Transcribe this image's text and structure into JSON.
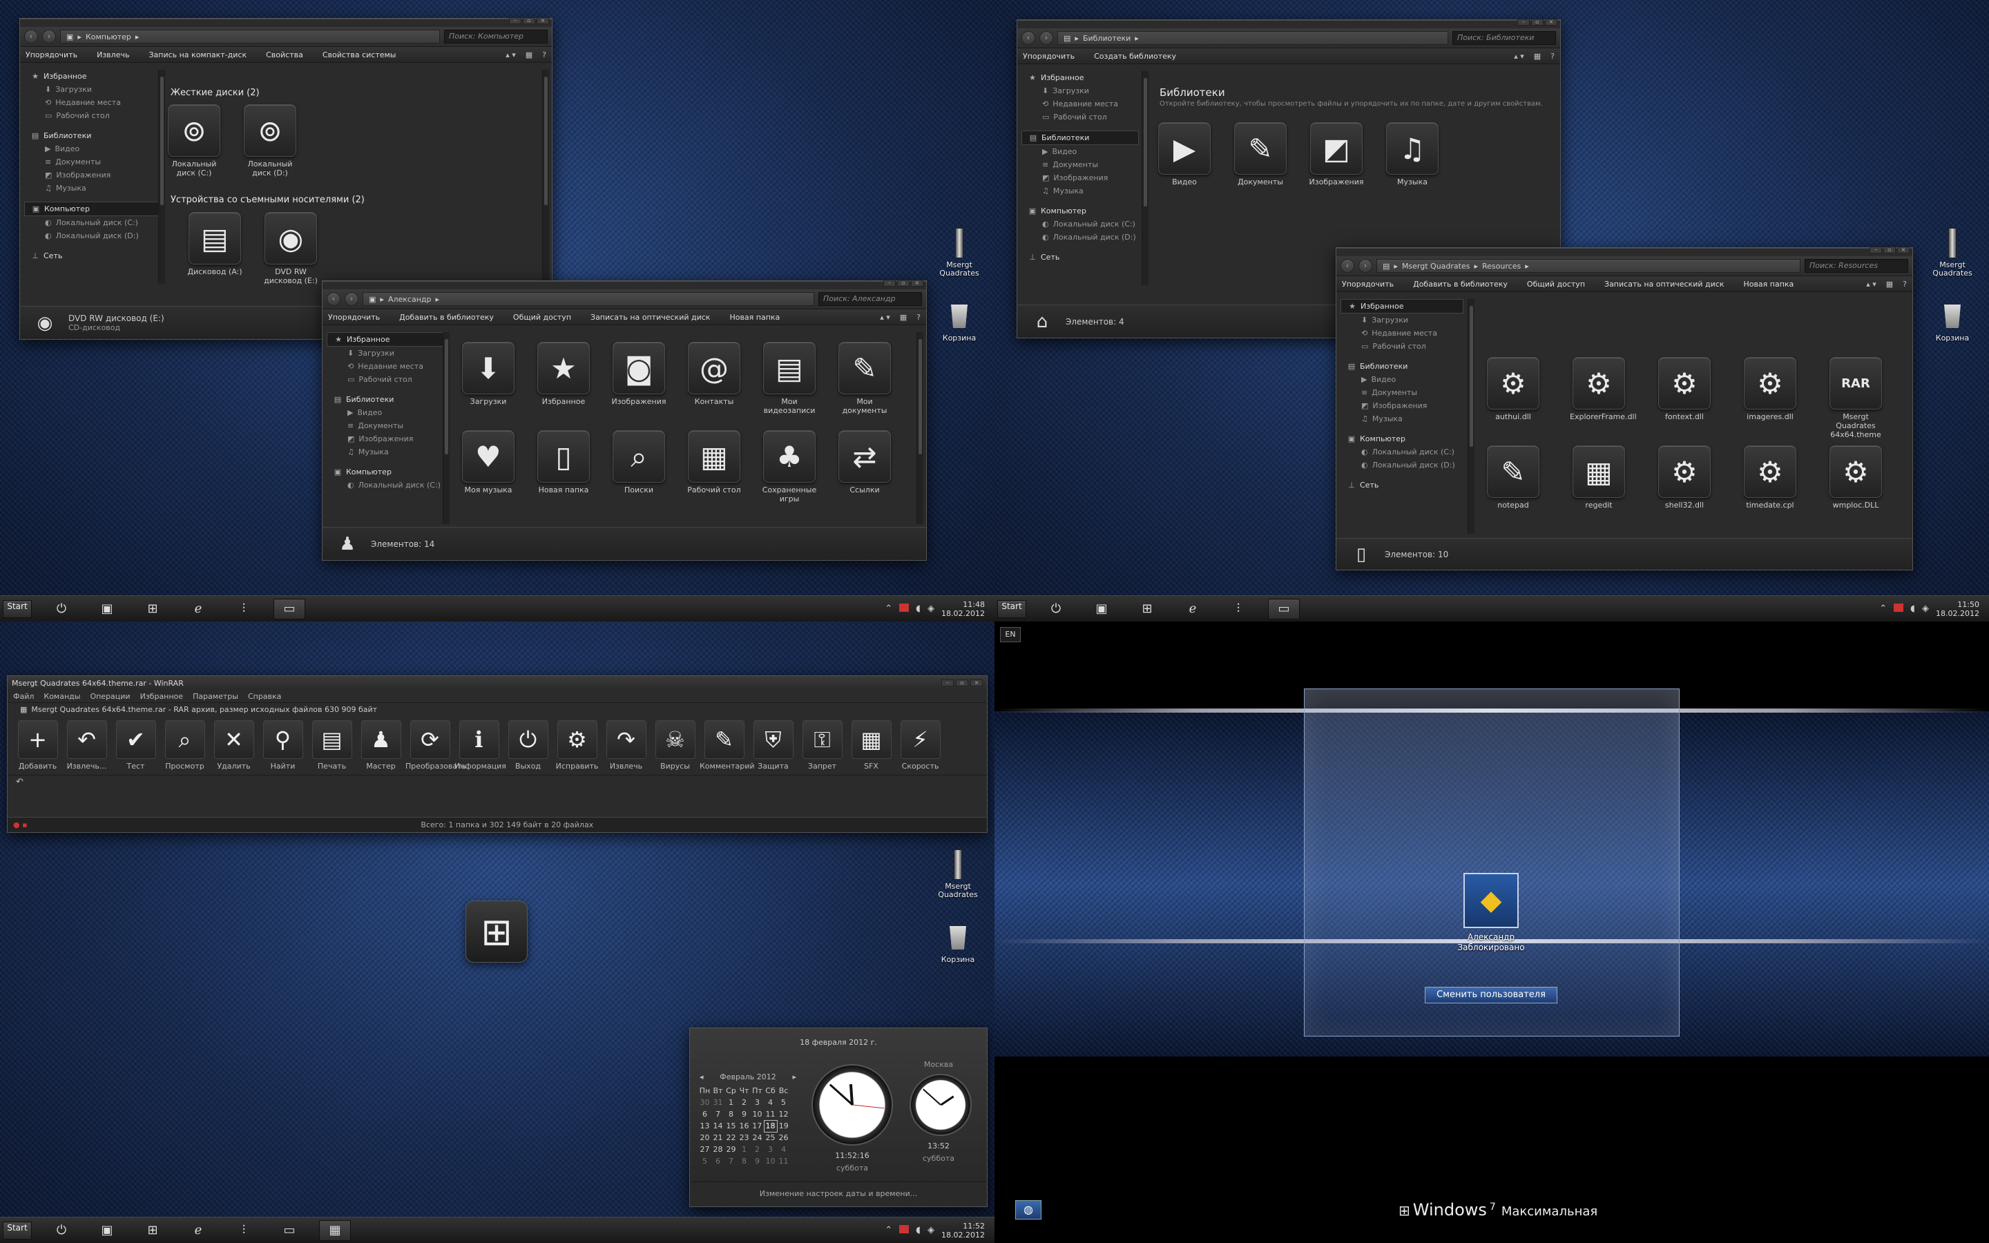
{
  "colors": {
    "desktop": "#1a3260",
    "window": "#2b2b2b",
    "lock_bg": "#000000",
    "accent_blue": "#2a5aa6"
  },
  "q1": {
    "win_computer": {
      "address": "Компьютер",
      "search": "Поиск: Компьютер",
      "commands": [
        "Упорядочить",
        "Извлечь",
        "Запись на компакт-диск",
        "Свойства",
        "Свойства системы"
      ],
      "nav": {
        "favorites": "Избранное",
        "fav_items": [
          "Загрузки",
          "Недавние места",
          "Рабочий стол"
        ],
        "libraries": "Библиотеки",
        "lib_items": [
          "Видео",
          "Документы",
          "Изображения",
          "Музыка"
        ],
        "computer": "Компьютер",
        "comp_items": [
          "Локальный диск (C:)",
          "Локальный диск (D:)"
        ],
        "network": "Сеть"
      },
      "section_hdd": "Жесткие диски (2)",
      "drives": [
        "Локальный диск (C:)",
        "Локальный диск (D:)"
      ],
      "section_removable": "Устройства со съемными носителями (2)",
      "removable": [
        "Дисковод (A:)",
        "DVD RW дисковод (E:)"
      ],
      "status_title": "DVD RW дисковод (E:)",
      "status_sub": "CD-дисковод"
    },
    "win_user": {
      "address": "Александр",
      "search": "Поиск: Александр",
      "commands": [
        "Упорядочить",
        "Добавить в библиотеку",
        "Общий доступ",
        "Записать на оптический диск",
        "Новая папка"
      ],
      "nav": {
        "favorites": "Избранное",
        "fav_items": [
          "Загрузки",
          "Недавние места",
          "Рабочий стол"
        ],
        "libraries": "Библиотеки",
        "lib_items": [
          "Видео",
          "Документы",
          "Изображения",
          "Музыка"
        ],
        "computer": "Компьютер",
        "comp_items": [
          "Локальный диск (C:)"
        ]
      },
      "folders": [
        "Загрузки",
        "Избранное",
        "Изображения",
        "Контакты",
        "Мои видеозаписи",
        "Мои документы",
        "Моя музыка",
        "Новая папка",
        "Поиски",
        "Рабочий стол",
        "Сохраненные игры",
        "Ссылки"
      ],
      "status": "Элементов: 14"
    },
    "desktop_icons": [
      "Msergt Quadrates",
      "Корзина"
    ],
    "taskbar": {
      "start": "Start",
      "time": "11:48",
      "date": "18.02.2012"
    }
  },
  "q2": {
    "win_libraries": {
      "address": "Библиотеки",
      "search": "Поиск: Библиотеки",
      "commands": [
        "Упорядочить",
        "Создать библиотеку"
      ],
      "title": "Библиотеки",
      "subtitle": "Откройте библиотеку, чтобы просмотреть файлы и упорядочить их по папке, дате и другим свойствам.",
      "nav": {
        "favorites": "Избранное",
        "fav_items": [
          "Загрузки",
          "Недавние места",
          "Рабочий стол"
        ],
        "libraries": "Библиотеки",
        "lib_items": [
          "Видео",
          "Документы",
          "Изображения",
          "Музыка"
        ],
        "computer": "Компьютер",
        "comp_items": [
          "Локальный диск (C:)",
          "Локальный диск (D:)"
        ],
        "network": "Сеть"
      },
      "libs": [
        "Видео",
        "Документы",
        "Изображения",
        "Музыка"
      ],
      "status": "Элементов: 4"
    },
    "win_resources": {
      "address_1": "Msergt Quadrates",
      "address_2": "Resources",
      "search": "Поиск: Resources",
      "commands": [
        "Упорядочить",
        "Добавить в библиотеку",
        "Общий доступ",
        "Записать на оптический диск",
        "Новая папка"
      ],
      "nav": {
        "favorites": "Избранное",
        "fav_items": [
          "Загрузки",
          "Недавние места",
          "Рабочий стол"
        ],
        "libraries": "Библиотеки",
        "lib_items": [
          "Видео",
          "Документы",
          "Изображения",
          "Музыка"
        ],
        "computer": "Компьютер",
        "comp_items": [
          "Локальный диск (C:)",
          "Локальный диск (D:)"
        ],
        "network": "Сеть"
      },
      "files": [
        "authui.dll",
        "ExplorerFrame.dll",
        "fontext.dll",
        "imageres.dll",
        "Msergt Quadrates 64x64.theme",
        "notepad",
        "regedit",
        "shell32.dll",
        "timedate.cpl",
        "wmploc.DLL"
      ],
      "status": "Элементов: 10"
    },
    "desktop_icons": [
      "Msergt Quadrates",
      "Корзина"
    ],
    "taskbar": {
      "start": "Start",
      "time": "11:50",
      "date": "18.02.2012"
    }
  },
  "q3": {
    "winrar": {
      "title": "Msergt Quadrates 64x64.theme.rar - WinRAR",
      "menu": [
        "Файл",
        "Команды",
        "Операции",
        "Избранное",
        "Параметры",
        "Справка"
      ],
      "archive_info": "Msergt Quadrates 64x64.theme.rar - RAR архив, размер исходных файлов 630 909 байт",
      "tools": [
        "Добавить",
        "Извлечь...",
        "Тест",
        "Просмотр",
        "Удалить",
        "Найти",
        "Печать",
        "Мастер",
        "Преобразовать",
        "Информация",
        "Выход",
        "Исправить",
        "Извлечь",
        "Вирусы",
        "Комментарий",
        "Защита",
        "Запрет",
        "SFX",
        "Скорость"
      ],
      "status": "Всего: 1 папка и 302 149 байт в 20 файлах"
    },
    "calendar": {
      "header": "18 февраля 2012 г.",
      "month": "Февраль 2012",
      "weekdays": [
        "Пн",
        "Вт",
        "Ср",
        "Чт",
        "Пт",
        "Сб",
        "Вс"
      ],
      "rows": [
        [
          "30",
          "31",
          "1",
          "2",
          "3",
          "4",
          "5"
        ],
        [
          "6",
          "7",
          "8",
          "9",
          "10",
          "11",
          "12"
        ],
        [
          "13",
          "14",
          "15",
          "16",
          "17",
          "18",
          "19"
        ],
        [
          "20",
          "21",
          "22",
          "23",
          "24",
          "25",
          "26"
        ],
        [
          "27",
          "28",
          "29",
          "1",
          "2",
          "3",
          "4"
        ],
        [
          "5",
          "6",
          "7",
          "8",
          "9",
          "10",
          "11"
        ]
      ],
      "today": "18",
      "clock1_time": "11:52:16",
      "clock1_day": "суббота",
      "clock2_city": "Москва",
      "clock2_time": "13:52",
      "clock2_day": "суббота",
      "footer": "Изменение настроек даты и времени..."
    },
    "desktop_icons": [
      "Msergt Quadrates",
      "Корзина"
    ],
    "taskbar": {
      "start": "Start",
      "time": "11:52",
      "date": "18.02.2012"
    }
  },
  "q4": {
    "lang": "EN",
    "user": "Александр",
    "user_state": "Заблокировано",
    "switch_user": "Сменить пользователя",
    "brand": "Windows",
    "brand_ver": "7",
    "edition": "Максимальная"
  }
}
